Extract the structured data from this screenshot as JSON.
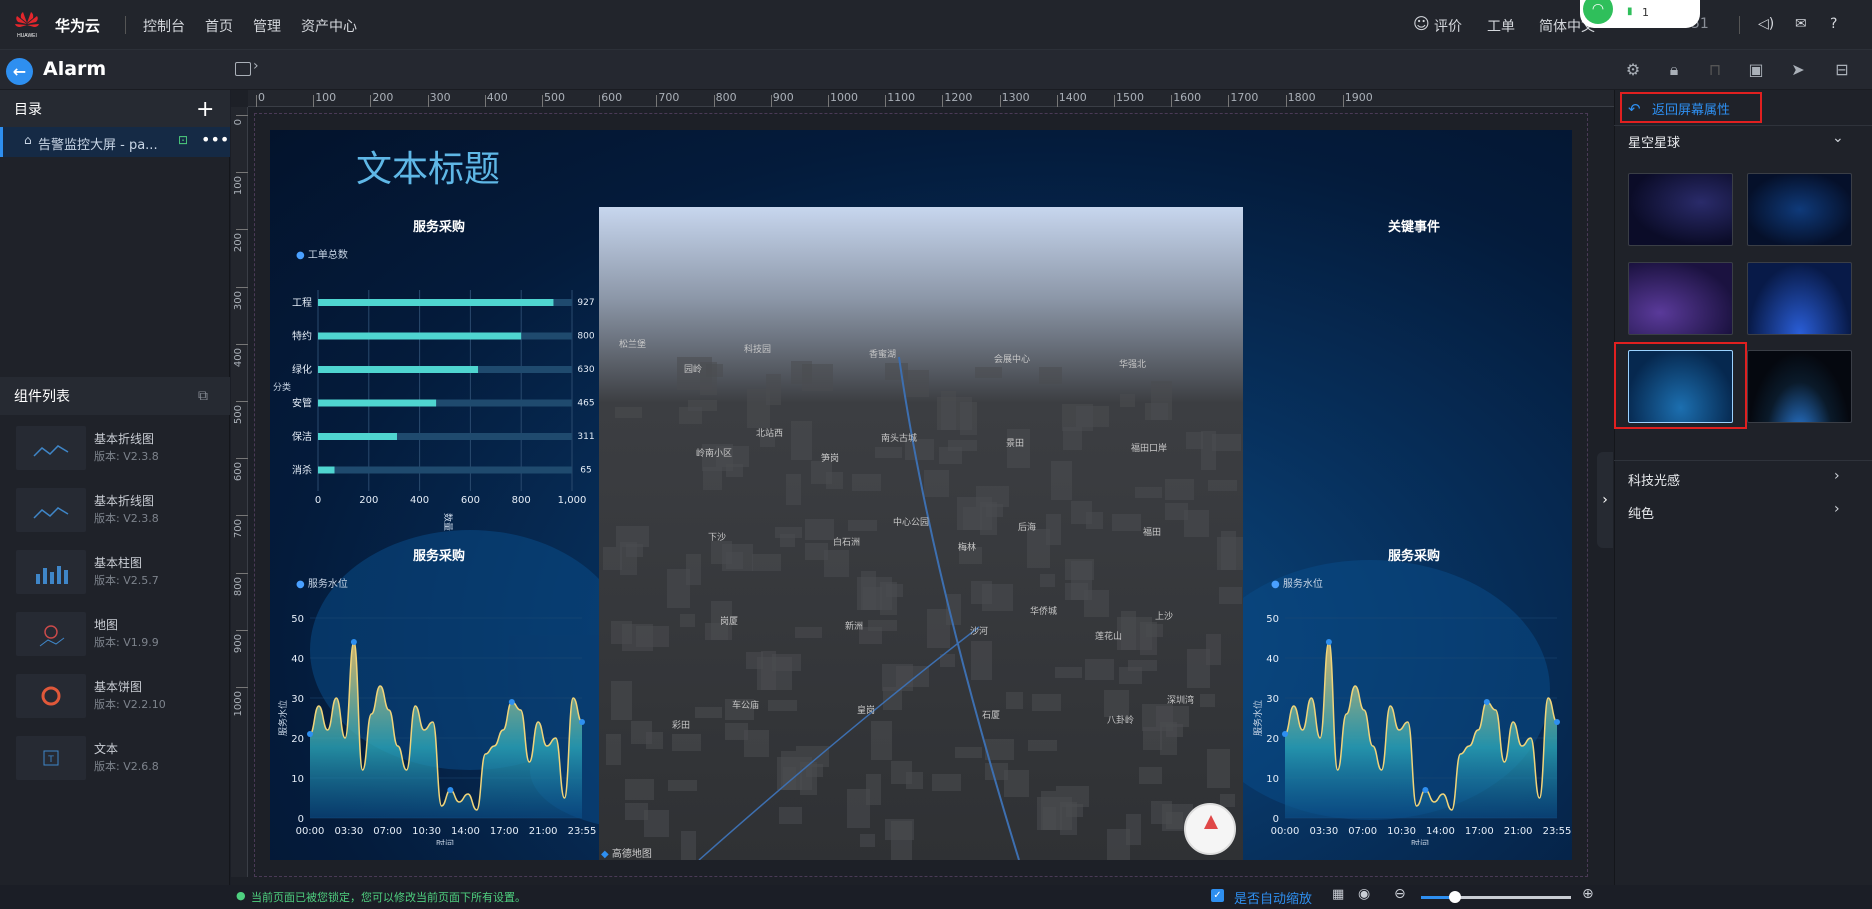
{
  "topbar": {
    "brand": "华为云",
    "logo_text": "HUAWEI",
    "nav": [
      "控制台",
      "首页",
      "管理",
      "资产中心"
    ],
    "right": {
      "feedback": "评价",
      "ticket": "工单",
      "language": "简体中文",
      "account": "51"
    },
    "wifi_badge": "1"
  },
  "app": {
    "title": "Alarm"
  },
  "sidebar": {
    "catalog_title": "目录",
    "tree_item": "告警监控大屏 - pa...",
    "components_title": "组件列表",
    "components": [
      {
        "name": "基本折线图",
        "version": "版本: V2.3.8",
        "icon": "line-chart-icon"
      },
      {
        "name": "基本折线图",
        "version": "版本: V2.3.8",
        "icon": "line-chart-icon"
      },
      {
        "name": "基本柱图",
        "version": "版本: V2.5.7",
        "icon": "bar-chart-icon"
      },
      {
        "name": "地图",
        "version": "版本: V1.9.9",
        "icon": "map-icon"
      },
      {
        "name": "基本饼图",
        "version": "版本: V2.2.10",
        "icon": "pie-chart-icon"
      },
      {
        "name": "文本",
        "version": "版本: V2.6.8",
        "icon": "text-icon"
      }
    ]
  },
  "ruler": {
    "h": [
      "0",
      "100",
      "200",
      "300",
      "400",
      "500",
      "600",
      "700",
      "800",
      "900",
      "1000",
      "1100",
      "1200",
      "1300",
      "1400",
      "1500",
      "1600",
      "1700",
      "1800",
      "1900"
    ],
    "v": [
      "0",
      "100",
      "200",
      "300",
      "400",
      "500",
      "600",
      "700",
      "800",
      "900",
      "1000"
    ]
  },
  "screen": {
    "title": "文本标题",
    "map_labels": [
      "松兰堡",
      "北站西",
      "中心公园",
      "华侨城",
      "深圳湾",
      "科技园",
      "南头古城",
      "后海",
      "上沙",
      "车公庙",
      "香蜜湖",
      "景田",
      "福田",
      "岗厦",
      "皇岗",
      "会展中心",
      "福田口岸",
      "下沙",
      "新洲",
      "石厦",
      "华强北",
      "岭南小区",
      "白石洲",
      "沙河",
      "八卦岭",
      "园岭",
      "笋岗",
      "梅林",
      "莲花山",
      "彩田"
    ],
    "map_logo": "高德地图"
  },
  "chart_data": [
    {
      "type": "bar",
      "title": "服务采购",
      "legend": [
        "工单总数"
      ],
      "ylabel": "分类",
      "xlabel": "数量",
      "categories": [
        "工程",
        "特约",
        "绿化",
        "安管",
        "保洁",
        "消杀"
      ],
      "values": [
        927,
        800,
        630,
        465,
        311,
        65
      ],
      "xlim": [
        0,
        1000
      ],
      "xticks": [
        "0",
        "200",
        "400",
        "600",
        "800",
        "1,000"
      ],
      "color": "#4fd5d0"
    },
    {
      "type": "area",
      "title": "服务采购",
      "legend": [
        "服务水位"
      ],
      "ylabel": "服务水位",
      "xlabel": "时间",
      "ylim": [
        0,
        50
      ],
      "yticks": [
        "0",
        "10",
        "20",
        "30",
        "40",
        "50"
      ],
      "xticks": [
        "00:00",
        "03:30",
        "07:00",
        "10:30",
        "14:00",
        "17:00",
        "21:00",
        "23:55"
      ],
      "values": [
        21,
        28,
        22,
        30,
        20,
        44,
        12,
        26,
        33,
        27,
        18,
        12,
        28,
        22,
        24,
        3,
        7,
        4,
        6,
        2,
        16,
        18,
        22,
        29,
        27,
        14,
        24,
        18,
        20,
        5,
        30,
        24
      ],
      "markers": [
        0,
        5,
        16,
        23,
        31
      ]
    },
    {
      "type": "area",
      "title": "服务采购",
      "legend": [
        "服务水位"
      ],
      "ylabel": "服务水位",
      "xlabel": "时间",
      "ylim": [
        0,
        50
      ],
      "yticks": [
        "0",
        "10",
        "20",
        "30",
        "40",
        "50"
      ],
      "xticks": [
        "00:00",
        "03:30",
        "07:00",
        "10:30",
        "14:00",
        "17:00",
        "21:00",
        "23:55"
      ],
      "values": [
        21,
        28,
        22,
        30,
        20,
        44,
        12,
        26,
        33,
        27,
        18,
        12,
        28,
        22,
        24,
        3,
        7,
        4,
        6,
        2,
        16,
        18,
        22,
        29,
        27,
        14,
        24,
        18,
        20,
        5,
        30,
        24
      ],
      "markers": [
        0,
        5,
        16,
        23,
        31
      ]
    }
  ],
  "events_title": "关键事件",
  "rightpanel": {
    "back_label": "返回屏幕属性",
    "section_open": "星空星球",
    "sections": [
      "科技光感",
      "纯色"
    ]
  },
  "footer": {
    "lock_notice": "当前页面已被您锁定，您可以修改当前页面下所有设置。",
    "auto_zoom": "是否自动缩放"
  },
  "colors": {
    "accent": "#2e8ff0",
    "title": "#5fb7e6",
    "warning": "#e02020"
  }
}
